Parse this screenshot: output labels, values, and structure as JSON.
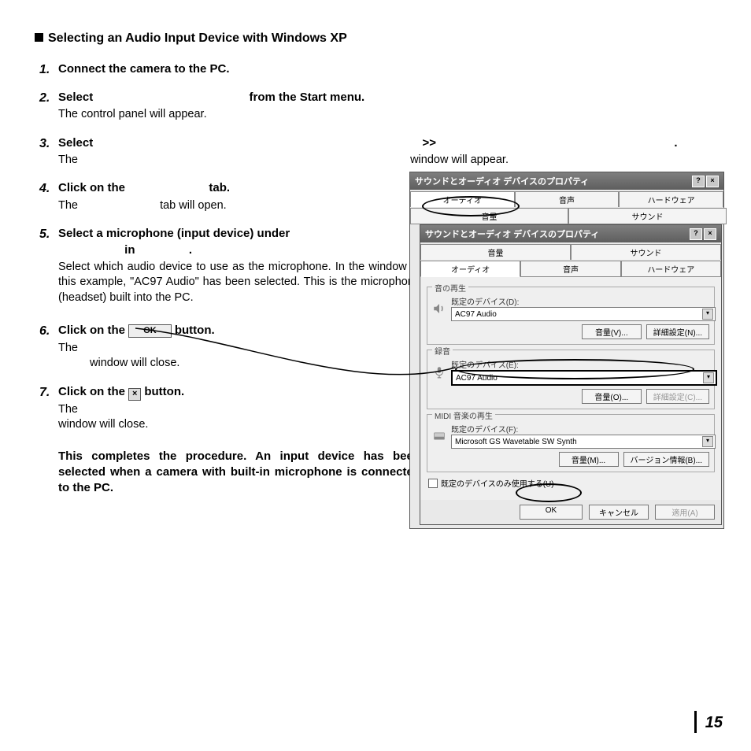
{
  "title": "Selecting an Audio Input Device with Windows XP",
  "steps": [
    {
      "num": "1.",
      "head": "Connect the camera to the PC.",
      "body": ""
    },
    {
      "num": "2.",
      "head_a": "Select",
      "head_b": "from the Start menu.",
      "body": "The control panel will appear."
    },
    {
      "num": "3.",
      "head_a": "Select",
      "arrows": ">>",
      "body_a": "The",
      "body_b": "window will appear."
    },
    {
      "num": "4.",
      "head_a": "Click on the",
      "head_b": "tab.",
      "body_a": "The",
      "body_b": "tab will open."
    },
    {
      "num": "5.",
      "head": "Select a microphone (input device) under",
      "head2_a": "in",
      "head2_b": ".",
      "body": "Select which audio device to use as the microphone. In the window of this example, \"AC97 Audio\" has been selected. This is the microphone (headset) built into the PC."
    },
    {
      "num": "6.",
      "head_a": "Click on the",
      "head_b": "button.",
      "body_a": "The",
      "body_b": "window will close."
    },
    {
      "num": "7.",
      "head_a": " Click on the",
      "head_b": "button.",
      "body": "The\nwindow will close."
    }
  ],
  "conclusion": "This completes the procedure. An input device has been selected when a camera with built-in microphone is connected to the PC.",
  "inline_ok": "OK",
  "figure": {
    "title": "サウンドとオーディオ デバイスのプロパティ",
    "tabs_top": [
      "オーディオ",
      "音声",
      "ハードウェア"
    ],
    "tabs_top_partial": [
      "音量",
      "サウンド"
    ],
    "tabs_inner1": [
      "音量",
      "サウンド"
    ],
    "tabs_inner2": [
      "オーディオ",
      "音声",
      "ハードウェア"
    ],
    "group_play": {
      "legend": "音の再生",
      "label": "既定のデバイス(D):",
      "value": "AC97 Audio",
      "btn1": "音量(V)...",
      "btn2": "詳細設定(N)..."
    },
    "group_rec": {
      "legend": "録音",
      "label": "既定のデバイス(E):",
      "value": "AC97 Audio",
      "btn1": "音量(O)...",
      "btn2": "詳細設定(C)..."
    },
    "group_midi": {
      "legend": "MIDI 音楽の再生",
      "label": "既定のデバイス(F):",
      "value": "Microsoft GS Wavetable SW Synth",
      "btn1": "音量(M)...",
      "btn2": "バージョン情報(B)..."
    },
    "checkbox": "既定のデバイスのみ使用する(U)",
    "ok": "OK",
    "cancel": "キャンセル",
    "apply": "適用(A)",
    "help": "?",
    "close": "×"
  },
  "page_number": "15"
}
